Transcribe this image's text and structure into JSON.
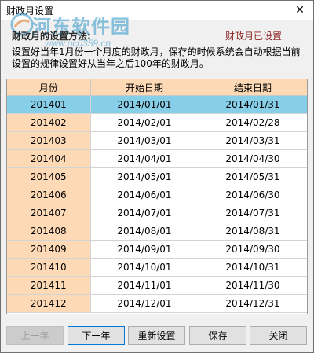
{
  "window": {
    "title": "财政月设置",
    "close_glyph": "✕"
  },
  "watermark": {
    "text": "河东软件园",
    "url": "www.pc0359.cn"
  },
  "header": {
    "label": "财政月的设置方法:",
    "status": "财政月已设置"
  },
  "description": "设置好当年1月份一个月度的财政月，保存的时候系统会自动根据当前设置的规律设置好从当年之后100年的财政月。",
  "table": {
    "columns": [
      "月份",
      "开始日期",
      "结束日期"
    ],
    "selected_index": 0,
    "rows": [
      [
        "201401",
        "2014/01/01",
        "2014/01/31"
      ],
      [
        "201402",
        "2014/02/01",
        "2014/02/28"
      ],
      [
        "201403",
        "2014/03/01",
        "2014/03/31"
      ],
      [
        "201404",
        "2014/04/01",
        "2014/04/30"
      ],
      [
        "201405",
        "2014/05/01",
        "2014/05/31"
      ],
      [
        "201406",
        "2014/06/01",
        "2014/06/30"
      ],
      [
        "201407",
        "2014/07/01",
        "2014/07/31"
      ],
      [
        "201408",
        "2014/08/01",
        "2014/08/31"
      ],
      [
        "201409",
        "2014/09/01",
        "2014/09/30"
      ],
      [
        "201410",
        "2014/10/01",
        "2014/10/31"
      ],
      [
        "201411",
        "2014/11/01",
        "2014/11/30"
      ],
      [
        "201412",
        "2014/12/01",
        "2014/12/31"
      ]
    ]
  },
  "buttons": {
    "prev_year": "上一年",
    "next_year": "下一年",
    "reset": "重新设置",
    "save": "保存",
    "close": "关闭"
  },
  "colors": {
    "header_bg": "#fdd9b5",
    "selected_row": "#87cfe8",
    "status_text": "#8b1e1e"
  }
}
